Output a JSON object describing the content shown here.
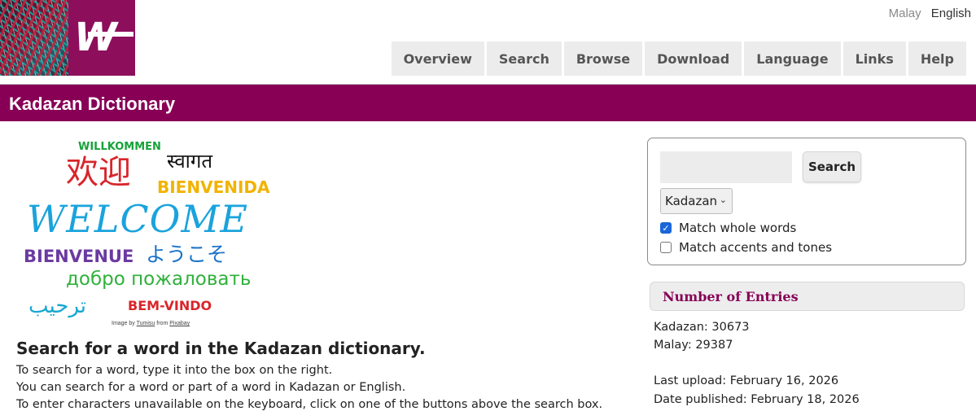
{
  "language_switch": {
    "items": [
      {
        "label": "Malay",
        "active": false
      },
      {
        "label": "English",
        "active": true
      }
    ]
  },
  "nav": {
    "items": [
      "Overview",
      "Search",
      "Browse",
      "Download",
      "Language",
      "Links",
      "Help"
    ]
  },
  "header": {
    "title": "Kadazan Dictionary"
  },
  "welcome_image": {
    "words": [
      "WILLKOMMEN",
      "स्वागत",
      "欢迎",
      "BIENVENIDA",
      "WELCOME",
      "BIENVENUE",
      "ようこそ",
      "добро пожаловать",
      "ترحيب",
      "BEM-VINDO"
    ],
    "credit_prefix": "Image by",
    "credit_author": "Tumisu",
    "credit_mid": "from",
    "credit_site": "Pixabay"
  },
  "intro": {
    "heading": "Search for a word in the Kadazan dictionary.",
    "lines": [
      "To search for a word, type it into the box on the right.",
      "You can search for a word or part of a word in Kadazan or English.",
      "To enter characters unavailable on the keyboard, click on one of the buttons above the search box."
    ]
  },
  "search": {
    "input_value": "",
    "button_label": "Search",
    "language_select": "Kadazan",
    "options": [
      {
        "label": "Match whole words",
        "checked": true
      },
      {
        "label": "Match accents and tones",
        "checked": false
      }
    ]
  },
  "entries": {
    "heading": "Number of Entries",
    "lines": [
      "Kadazan: 30673",
      "Malay: 29387",
      "Last upload: February 16, 2026",
      "Date published: February 18, 2026"
    ]
  },
  "colors": {
    "brand": "#870056",
    "checkbox": "#1a66d8"
  }
}
